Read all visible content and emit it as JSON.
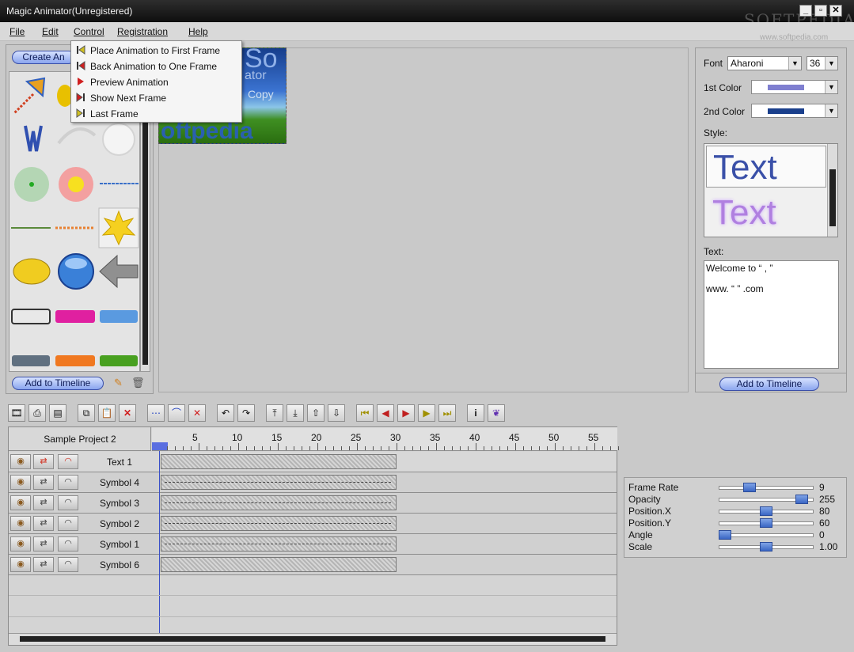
{
  "window": {
    "title": "Magic Animator(Unregistered)",
    "watermark": "SOFTPEDIA",
    "watermark_url": "www.softpedia.com"
  },
  "menu": [
    "File",
    "Edit",
    "Control",
    "Registration",
    "Help"
  ],
  "control_menu": [
    "Place Animation to First Frame",
    "Back Animation to One Frame",
    "Preview Animation",
    "Show Next Frame",
    "Last Frame"
  ],
  "library": {
    "create_label": "Create An",
    "add_label": "Add to Timeline"
  },
  "preview": {
    "text": "oftpedia",
    "sub1": "So",
    "sub2": "ator",
    "sub3": "Copy"
  },
  "right_panel": {
    "font_label": "Font",
    "font_value": "Aharoni",
    "size_value": "36",
    "color1_label": "1st Color",
    "color1": "#7f7fd0",
    "color2_label": "2nd Color",
    "color2": "#1a3f8c",
    "style_label": "Style:",
    "style_sample": "Text",
    "text_label": "Text:",
    "text_line1": "Welcome to “   ,  ”",
    "text_line2": "www.    “  ”  .com",
    "add_label": "Add to Timeline"
  },
  "timeline": {
    "project": "Sample Project 2",
    "ruler": [
      "5",
      "10",
      "15",
      "20",
      "25",
      "30",
      "35",
      "40",
      "45",
      "50",
      "55"
    ],
    "tracks": [
      "Text 1",
      "Symbol 4",
      "Symbol 3",
      "Symbol 2",
      "Symbol 1",
      "Symbol 6"
    ]
  },
  "properties": [
    {
      "label": "Frame Rate",
      "value": "9",
      "level": 0.3
    },
    {
      "label": "Opacity",
      "value": "255",
      "level": 0.93
    },
    {
      "label": "Position.X",
      "value": "80",
      "level": 0.5
    },
    {
      "label": "Position.Y",
      "value": "60",
      "level": 0.5
    },
    {
      "label": "Angle",
      "value": "0",
      "level": 0.0
    },
    {
      "label": "Scale",
      "value": "1.00",
      "level": 0.5
    }
  ],
  "colors": {
    "accent": "#3a66c4",
    "title_bar": "#1a1a1a"
  }
}
